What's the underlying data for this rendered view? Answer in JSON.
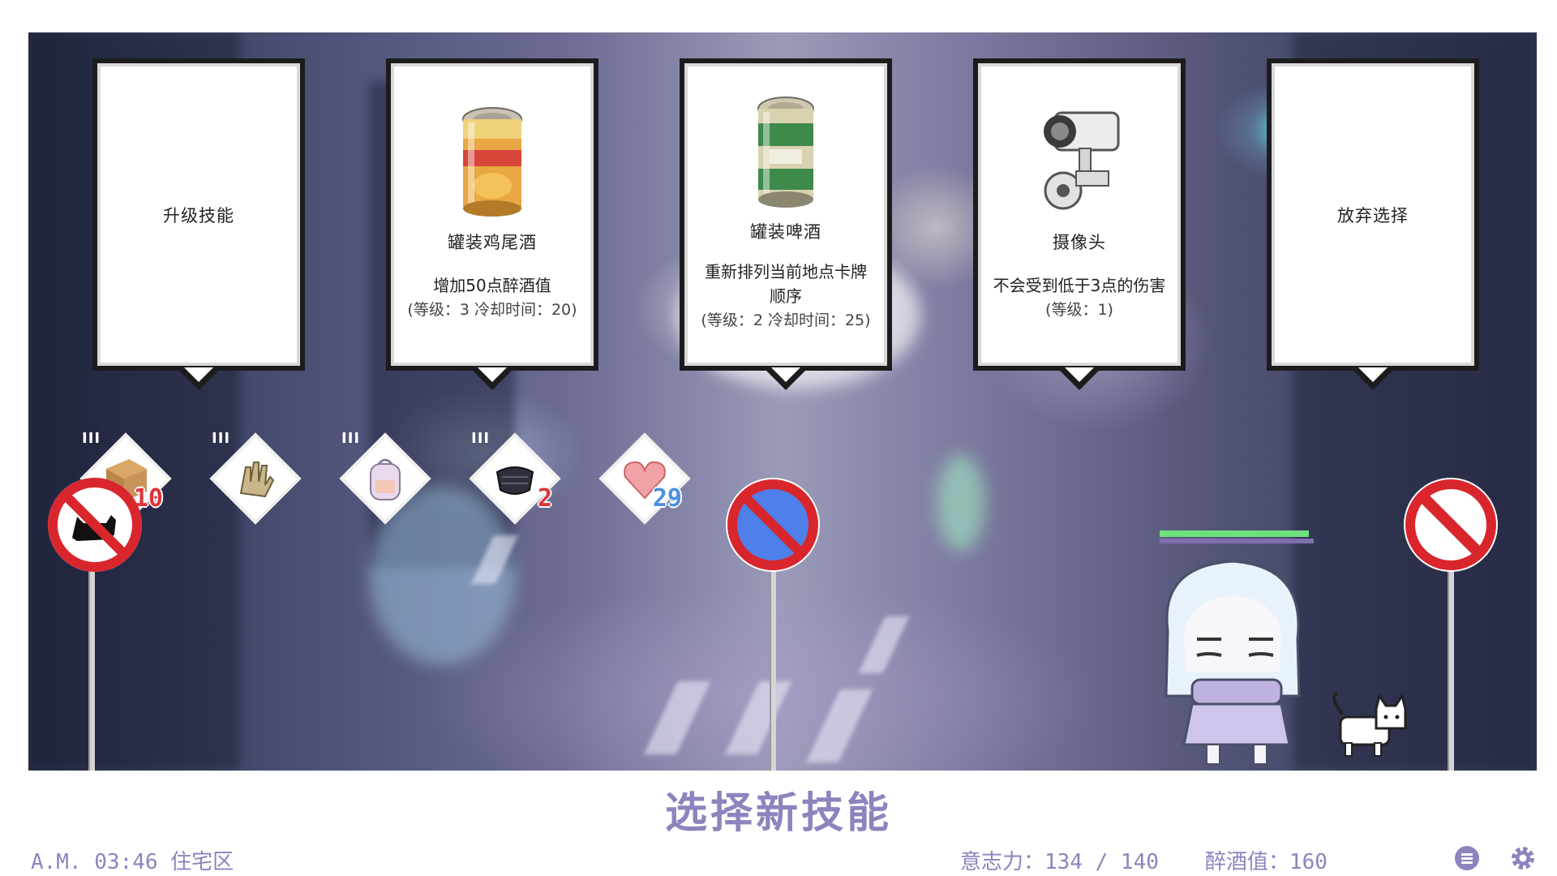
{
  "cards": [
    {
      "title": "升级技能",
      "description": "",
      "meta": "",
      "icon": "none"
    },
    {
      "title": "罐装鸡尾酒",
      "description": "增加50点醉酒值",
      "meta": "(等级：3 冷却时间：20)",
      "icon": "cocktail-can-icon"
    },
    {
      "title": "罐装啤酒",
      "description": "重新排列当前地点卡牌顺序",
      "meta": "(等级：2 冷却时间：25)",
      "icon": "beer-can-icon"
    },
    {
      "title": "摄像头",
      "description": "不会受到低于3点的伤害",
      "meta": "(等级：1)",
      "icon": "security-camera-icon"
    },
    {
      "title": "放弃选择",
      "description": "",
      "meta": "",
      "icon": "none"
    }
  ],
  "inventory": [
    {
      "name": "cardboard-box-icon",
      "ticks": "III",
      "count": "10",
      "count_color": "#e0333a"
    },
    {
      "name": "gloves-icon",
      "ticks": "III",
      "count": "",
      "count_color": ""
    },
    {
      "name": "backpack-icon",
      "ticks": "III",
      "count": "",
      "count_color": ""
    },
    {
      "name": "face-mask-icon",
      "ticks": "III",
      "count": "2",
      "count_color": "#e0333a"
    },
    {
      "name": "heart-icon",
      "ticks": "",
      "count": "29",
      "count_color": "#4d8fe0"
    }
  ],
  "player": {
    "hp_fraction": 0.97
  },
  "prompt": "选择新技能",
  "status": {
    "time_location": "A.M. 03:46 住宅区",
    "willpower": "意志力：134 / 140",
    "drunk": "醉酒值：160"
  },
  "icons": {
    "menu": "menu-icon",
    "settings": "settings-gear-icon"
  },
  "colors": {
    "accent": "#8d83bd",
    "hp": "#6fe07b",
    "sign_red": "#d9262c",
    "sign_blue": "#4f7fe8"
  }
}
